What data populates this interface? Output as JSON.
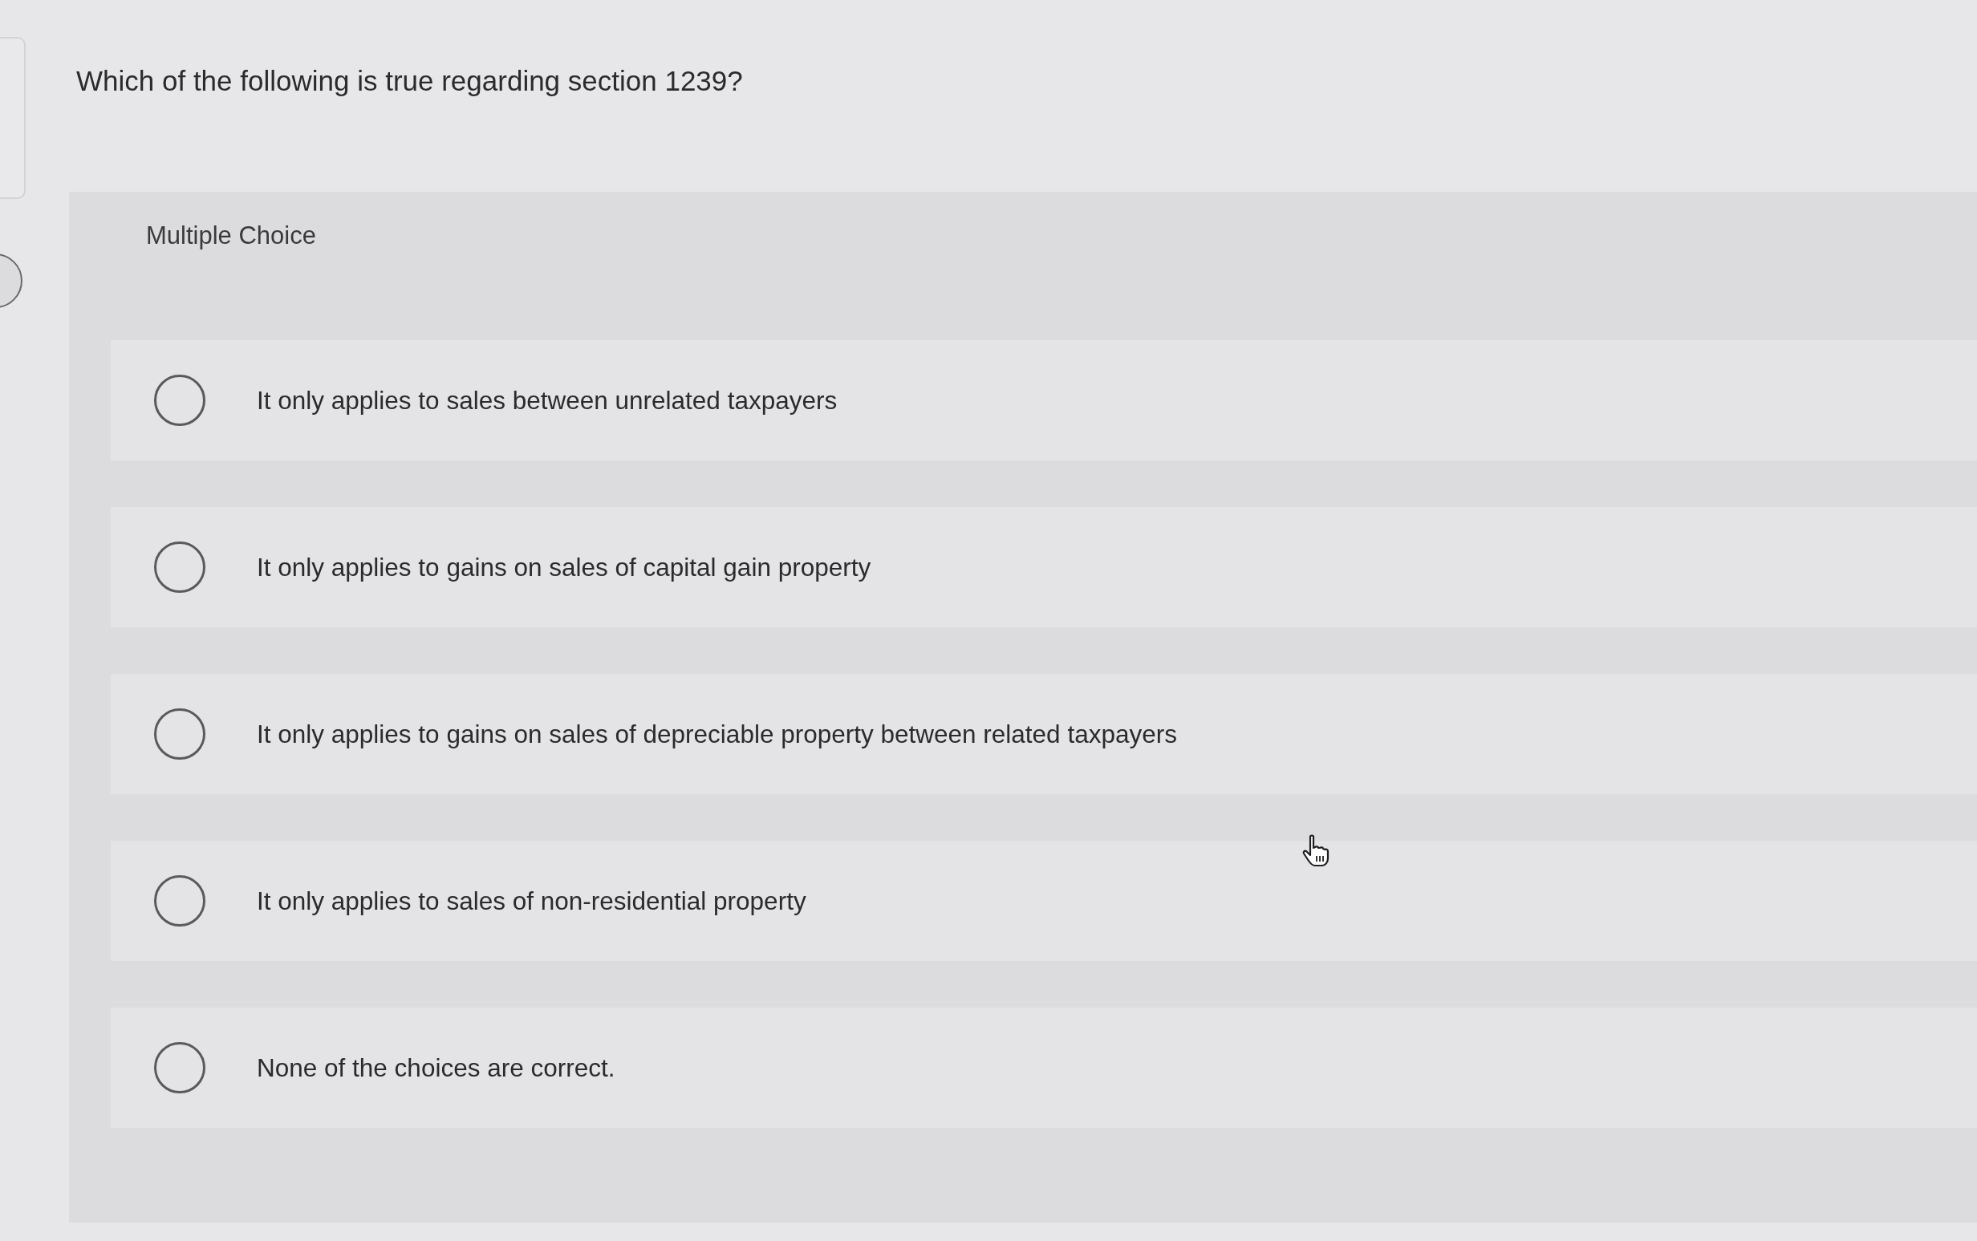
{
  "question": {
    "text": "Which of the following is true regarding section 1239?"
  },
  "answer_panel": {
    "label": "Multiple Choice",
    "options": [
      {
        "label": "It only applies to sales between unrelated taxpayers",
        "selected": false
      },
      {
        "label": "It only applies to gains on sales of capital gain property",
        "selected": false
      },
      {
        "label": "It only applies to gains on sales of depreciable property between related taxpayers",
        "selected": false
      },
      {
        "label": "It only applies to sales of non-residential property",
        "selected": false
      },
      {
        "label": "None of the choices are correct.",
        "selected": false
      }
    ]
  }
}
